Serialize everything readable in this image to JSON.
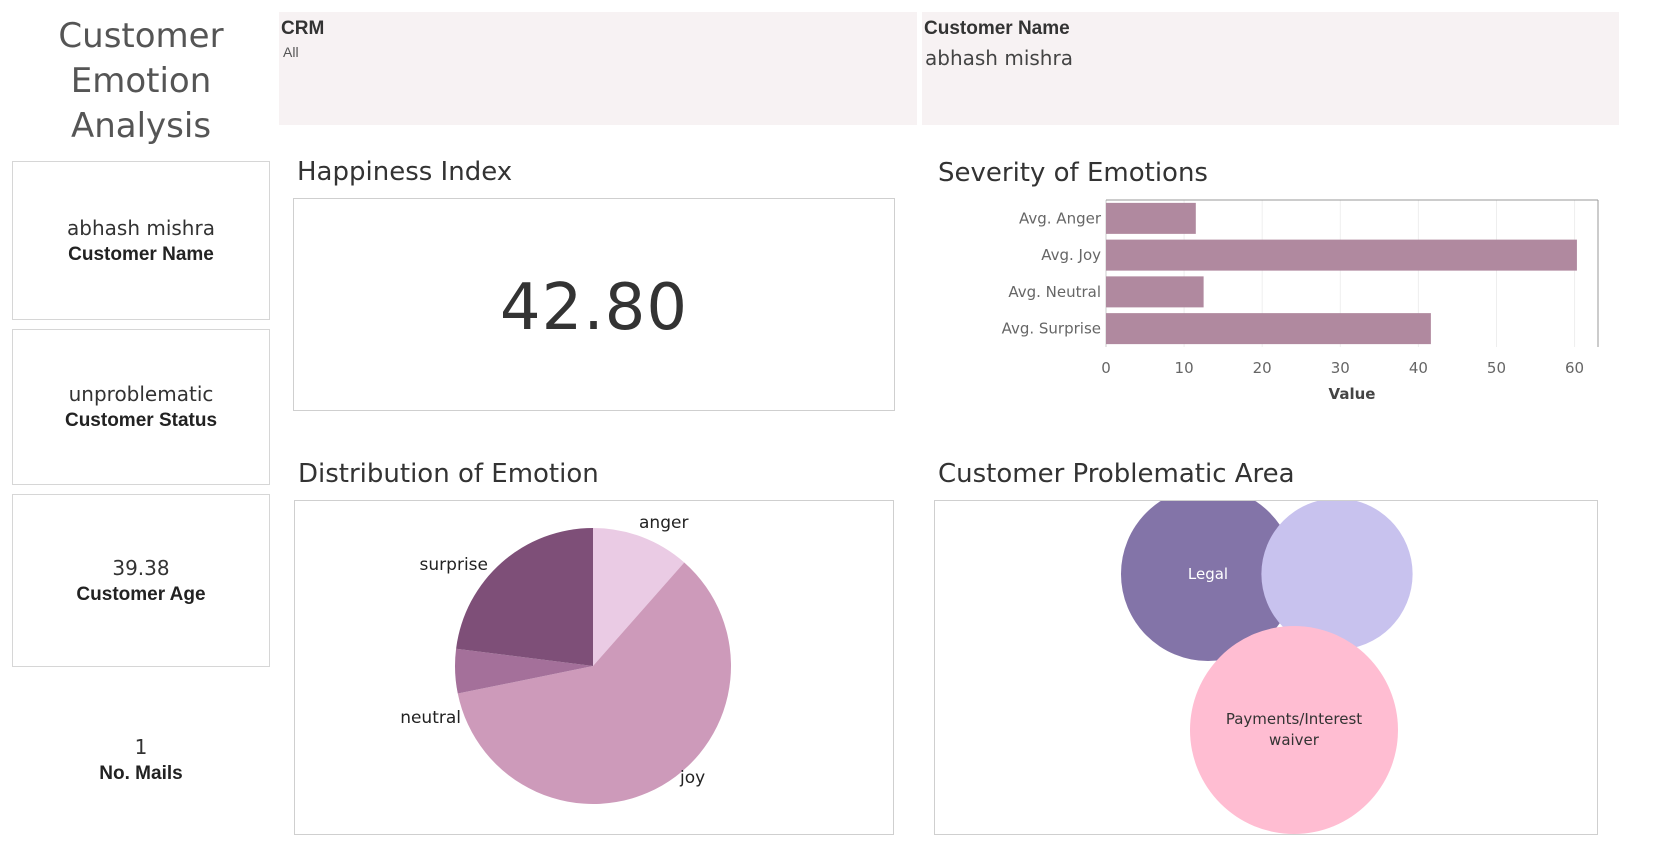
{
  "title": "Customer Emotion Analysis",
  "title_lines": [
    "Customer",
    "Emotion",
    "Analysis"
  ],
  "filters": {
    "crm": {
      "label": "CRM",
      "value": "All"
    },
    "customer_name": {
      "label": "Customer Name",
      "value": "abhash mishra"
    }
  },
  "kpis": {
    "name": {
      "value": "abhash mishra",
      "label": "Customer Name"
    },
    "status": {
      "value": "unproblematic",
      "label": "Customer Status"
    },
    "age": {
      "value": "39.38",
      "label": "Customer Age"
    },
    "mails": {
      "value": "1",
      "label": "No. Mails"
    }
  },
  "happiness": {
    "title": "Happiness Index",
    "value": "42.80"
  },
  "severity": {
    "title": "Severity of Emotions"
  },
  "distribution": {
    "title": "Distribution of Emotion"
  },
  "problem_area": {
    "title": "Customer Problematic Area"
  },
  "chart_data": [
    {
      "type": "bar",
      "orientation": "horizontal",
      "title": "Severity of Emotions",
      "categories": [
        "Avg. Anger",
        "Avg. Joy",
        "Avg. Neutral",
        "Avg. Surprise"
      ],
      "values": [
        11.5,
        60.3,
        12.5,
        41.6
      ],
      "xlabel": "Value",
      "ylabel": "",
      "xlim": [
        0,
        63
      ],
      "ticks": [
        0,
        10,
        20,
        30,
        40,
        50,
        60
      ],
      "grid": true,
      "color": "#b0899f"
    },
    {
      "type": "pie",
      "title": "Distribution of Emotion",
      "categories": [
        "anger",
        "joy",
        "neutral",
        "surprise"
      ],
      "values": [
        11.5,
        60.3,
        5.2,
        23.0
      ],
      "colors": [
        "#eacbe4",
        "#cd9aba",
        "#a4709a",
        "#7e4f78"
      ]
    },
    {
      "type": "bubble",
      "title": "Customer Problematic Area",
      "categories": [
        "Legal",
        "",
        "Payments/Interest waiver"
      ],
      "values": [
        49,
        37,
        70
      ],
      "colors": [
        "#8374a8",
        "#c8c2ee",
        "#ffbdd2"
      ]
    }
  ]
}
